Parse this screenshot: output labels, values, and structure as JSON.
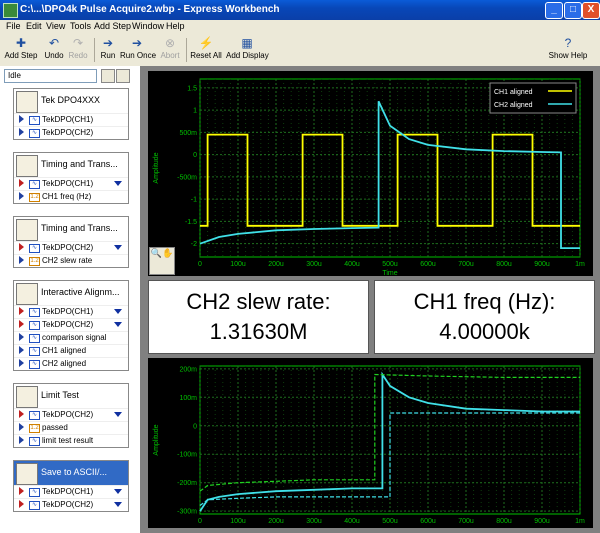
{
  "window": {
    "title": "C:\\...\\DPO4k Pulse Acquire2.wbp - Express Workbench",
    "minimize": "_",
    "maximize": "□",
    "close": "X"
  },
  "menu": [
    "File",
    "Edit",
    "View",
    "Tools",
    "Add Step",
    "Window",
    "Help"
  ],
  "toolbar": {
    "add_step": "Add Step",
    "undo": "Undo",
    "redo": "Redo",
    "run": "Run",
    "run_once": "Run Once",
    "abort": "Abort",
    "reset_all": "Reset All",
    "add_display": "Add Display",
    "show_help": "Show Help"
  },
  "status": "Idle",
  "steps": [
    {
      "label": "Tek DPO4XXX",
      "icon": "oscilloscope-icon",
      "rows": [
        {
          "dir": "out",
          "type": "waveform",
          "label": "TekDPO(CH1)"
        },
        {
          "dir": "out",
          "type": "waveform",
          "label": "TekDPO(CH2)"
        }
      ]
    },
    {
      "label": "Timing and Trans...",
      "icon": "timing-icon",
      "rows": [
        {
          "dir": "in",
          "type": "waveform",
          "label": "TekDPO(CH1)",
          "dropdown": true
        },
        {
          "dir": "out",
          "type": "number",
          "label": "CH1 freq (Hz)"
        }
      ]
    },
    {
      "label": "Timing and Trans...",
      "icon": "timing-icon",
      "rows": [
        {
          "dir": "in",
          "type": "waveform",
          "label": "TekDPO(CH2)",
          "dropdown": true
        },
        {
          "dir": "out",
          "type": "number",
          "label": "CH2 slew rate"
        }
      ]
    },
    {
      "label": "Interactive Alignm...",
      "icon": "alignment-icon",
      "rows": [
        {
          "dir": "in",
          "type": "waveform",
          "label": "TekDPO(CH1)",
          "dropdown": true
        },
        {
          "dir": "in",
          "type": "waveform",
          "label": "TekDPO(CH2)",
          "dropdown": true
        },
        {
          "dir": "out",
          "type": "waveform",
          "label": "comparison signal"
        },
        {
          "dir": "out",
          "type": "waveform",
          "label": "CH1 aligned"
        },
        {
          "dir": "out",
          "type": "waveform",
          "label": "CH2 aligned"
        }
      ]
    },
    {
      "label": "Limit Test",
      "icon": "limit-test-icon",
      "rows": [
        {
          "dir": "in",
          "type": "waveform",
          "label": "TekDPO(CH2)",
          "dropdown": true
        },
        {
          "dir": "out",
          "type": "number",
          "label": "passed"
        },
        {
          "dir": "out",
          "type": "waveform",
          "label": "limit test result"
        }
      ]
    },
    {
      "label": "Save to ASCII/...",
      "icon": "save-ascii-icon",
      "selected": true,
      "rows": [
        {
          "dir": "in",
          "type": "waveform",
          "label": "TekDPO(CH1)",
          "dropdown": true
        },
        {
          "dir": "in",
          "type": "waveform",
          "label": "TekDPO(CH2)",
          "dropdown": true
        }
      ]
    }
  ],
  "readouts": [
    {
      "name": "CH2 slew rate:",
      "value": "1.31630M"
    },
    {
      "name": "CH1 freq (Hz):",
      "value": "4.00000k"
    }
  ],
  "colors": {
    "ch1": "#ffff00",
    "ch2": "#40e0e8",
    "grid": "#1e6e1e",
    "axis": "#00c000",
    "limit": "#20d020"
  },
  "chart_data": [
    {
      "type": "line",
      "title": "",
      "xlabel": "Time",
      "ylabel": "Amplitude",
      "x_ticks": [
        "0",
        "100u",
        "200u",
        "300u",
        "400u",
        "500u",
        "600u",
        "700u",
        "800u",
        "900u",
        "1m"
      ],
      "y_ticks": [
        "1.5",
        "1",
        "500m",
        "0",
        "-500m",
        "-1",
        "-1.5",
        "-2"
      ],
      "xlim": [
        0,
        0.001
      ],
      "ylim": [
        -2.3,
        1.7
      ],
      "legend": "top-right",
      "series": [
        {
          "name": "CH1 aligned",
          "color": "#ffff00",
          "x": [
            0,
            2e-05,
            2e-05,
            0.000125,
            0.000125,
            0.00027,
            0.00027,
            0.000375,
            0.000375,
            0.00052,
            0.00052,
            0.000625,
            0.000625,
            0.00077,
            0.00077,
            0.000875,
            0.000875,
            0.001
          ],
          "y": [
            -1.6,
            -1.6,
            0.45,
            0.45,
            -1.6,
            -1.6,
            0.45,
            0.45,
            -1.6,
            -1.6,
            0.45,
            0.45,
            -1.6,
            -1.6,
            0.45,
            0.45,
            -1.6,
            -1.6
          ]
        },
        {
          "name": "CH2 aligned",
          "color": "#40e0e8",
          "x": [
            0,
            5e-05,
            0.0001,
            0.0002,
            0.0003,
            0.0004,
            0.00047,
            0.00047,
            0.0005,
            0.00055,
            0.0006,
            0.0007,
            0.0008,
            0.0009,
            0.00095,
            0.00095,
            0.001
          ],
          "y": [
            -2.0,
            -1.85,
            -1.78,
            -1.7,
            -1.67,
            -1.65,
            -1.64,
            1.2,
            0.65,
            0.35,
            0.22,
            0.12,
            0.08,
            0.06,
            0.05,
            -2.1,
            -2.1
          ]
        }
      ]
    },
    {
      "type": "line",
      "title": "",
      "xlabel": "",
      "ylabel": "Amplitude",
      "x_ticks": [
        "0",
        "100u",
        "200u",
        "300u",
        "400u",
        "500u",
        "600u",
        "700u",
        "800u",
        "900u",
        "1m"
      ],
      "y_ticks": [
        "200m",
        "100m",
        "0",
        "-100m",
        "-200m",
        "-300m"
      ],
      "xlim": [
        0,
        0.001
      ],
      "ylim": [
        -0.31,
        0.21
      ],
      "series": [
        {
          "color": "#40e0e8",
          "x": [
            0,
            2e-05,
            5e-05,
            0.0001,
            0.0002,
            0.0003,
            0.0004,
            0.00048,
            0.00048,
            0.0005,
            0.00055,
            0.0006,
            0.0007,
            0.0008,
            0.0009,
            0.001
          ],
          "y": [
            -0.3,
            -0.26,
            -0.25,
            -0.24,
            -0.23,
            -0.225,
            -0.22,
            -0.22,
            0.18,
            0.14,
            0.1,
            0.08,
            0.06,
            0.055,
            0.05,
            0.05
          ]
        },
        {
          "color": "#20d020",
          "dash": true,
          "x": [
            0,
            2e-05,
            0.0001,
            0.0002,
            0.0003,
            0.0004,
            0.00046,
            0.00046,
            0.0006,
            0.0008,
            0.001
          ],
          "y": [
            -0.23,
            -0.21,
            -0.2,
            -0.195,
            -0.19,
            -0.19,
            -0.19,
            0.18,
            0.175,
            0.17,
            0.17
          ]
        },
        {
          "color": "#40e0e8",
          "dash": true,
          "x": [
            0,
            2e-05,
            0.0001,
            0.0002,
            0.0003,
            0.0004,
            0.0005,
            0.0005,
            0.0006,
            0.0008,
            0.001
          ],
          "y": [
            -0.28,
            -0.26,
            -0.255,
            -0.25,
            -0.25,
            -0.25,
            -0.25,
            0.045,
            0.045,
            0.045,
            0.045
          ]
        }
      ]
    }
  ]
}
